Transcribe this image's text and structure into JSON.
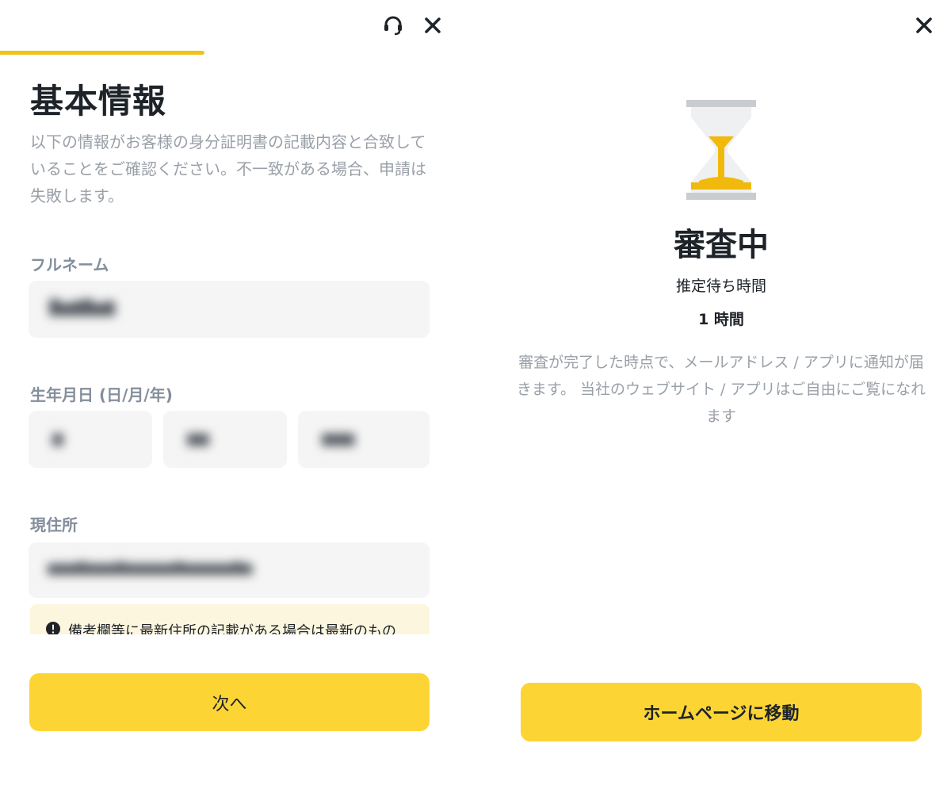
{
  "left": {
    "title": "基本情報",
    "description": "以下の情報がお客様の身分証明書の記載内容と合致していることをご確認ください。不一致がある場合、申請は失敗します。",
    "progress": 0.44,
    "fields": {
      "full_name_label": "フルネーム",
      "dob_label": "生年月日 (日/月/年)",
      "address_label": "現住所"
    },
    "notice": "備考欄等に最新住所の記載がある場合は最新のもの",
    "next_button": "次へ",
    "icons": {
      "support": "headset-icon",
      "close": "close-icon",
      "notice": "exclamation-circle-icon"
    }
  },
  "right": {
    "status_title": "審査中",
    "wait_label": "推定待ち時間",
    "wait_value": "1 時間",
    "info": "審査が完了した時点で、メールアドレス / アプリに通知が届きます。 当社のウェブサイト / アプリはご自由にご覧になれます",
    "home_button": "ホームページに移動",
    "icons": {
      "close": "close-icon",
      "status": "hourglass-icon"
    }
  },
  "colors": {
    "accent": "#fcd535",
    "progress": "#f0c21a",
    "hourglass_sand": "#f0b90b",
    "hourglass_cap": "#c9ccd1",
    "text_primary": "#1e2329",
    "text_secondary": "#9aa0a8",
    "notice_bg": "#fdf6df"
  }
}
